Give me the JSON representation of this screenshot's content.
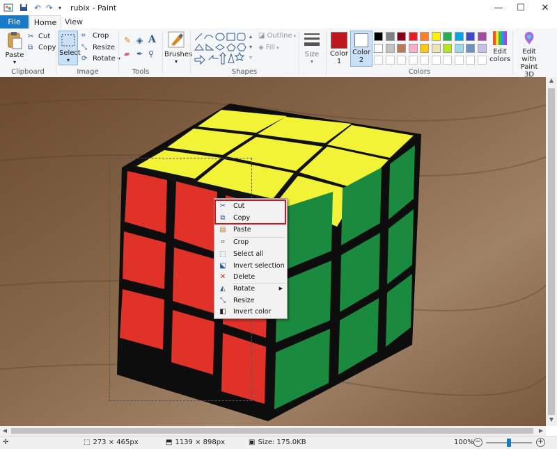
{
  "window": {
    "title": "rubix - Paint"
  },
  "tabs": [
    {
      "label": "File"
    },
    {
      "label": "Home"
    },
    {
      "label": "View"
    }
  ],
  "ribbon": {
    "clipboard": {
      "paste": "Paste",
      "cut": "Cut",
      "copy": "Copy",
      "label": "Clipboard"
    },
    "image": {
      "select": "Select",
      "crop": "Crop",
      "resize": "Resize",
      "rotate": "Rotate",
      "label": "Image"
    },
    "tools": {
      "label": "Tools",
      "text_glyph": "A"
    },
    "brushes": {
      "label": "Brushes"
    },
    "shapes": {
      "outline": "Outline",
      "fill": "Fill",
      "label": "Shapes"
    },
    "size": {
      "label": "Size"
    },
    "color1": {
      "label": "Color",
      "num": "1",
      "value": "#c0161e"
    },
    "color2": {
      "label": "Color",
      "num": "2",
      "value": "#ffffff"
    },
    "colors": {
      "label": "Colors"
    },
    "edit_colors": {
      "line1": "Edit",
      "line2": "colors"
    },
    "paint3d": {
      "line1": "Edit with",
      "line2": "Paint 3D"
    },
    "palette_top": [
      "#000000",
      "#7f7f7f",
      "#880015",
      "#ed1c24",
      "#ff7f27",
      "#fff200",
      "#22b14c",
      "#00a2e8",
      "#3f48cc",
      "#a349a4"
    ],
    "palette_bottom": [
      "#ffffff",
      "#c3c3c3",
      "#b97a57",
      "#ffaec9",
      "#ffc90e",
      "#efe4b0",
      "#b5e61d",
      "#99d9ea",
      "#7092be",
      "#c8bfe7"
    ]
  },
  "context_menu": {
    "items": [
      {
        "label": "Cut"
      },
      {
        "label": "Copy"
      },
      {
        "label": "Paste"
      },
      {
        "label": "Crop"
      },
      {
        "label": "Select all"
      },
      {
        "label": "Invert selection"
      },
      {
        "label": "Delete"
      },
      {
        "label": "Rotate"
      },
      {
        "label": "Resize"
      },
      {
        "label": "Invert color"
      }
    ]
  },
  "status": {
    "selection_size": "273 × 465px",
    "image_size": "1139 × 898px",
    "file_size": "Size: 175.0KB",
    "zoom": "100%",
    "zoom_fraction": 0.5
  }
}
